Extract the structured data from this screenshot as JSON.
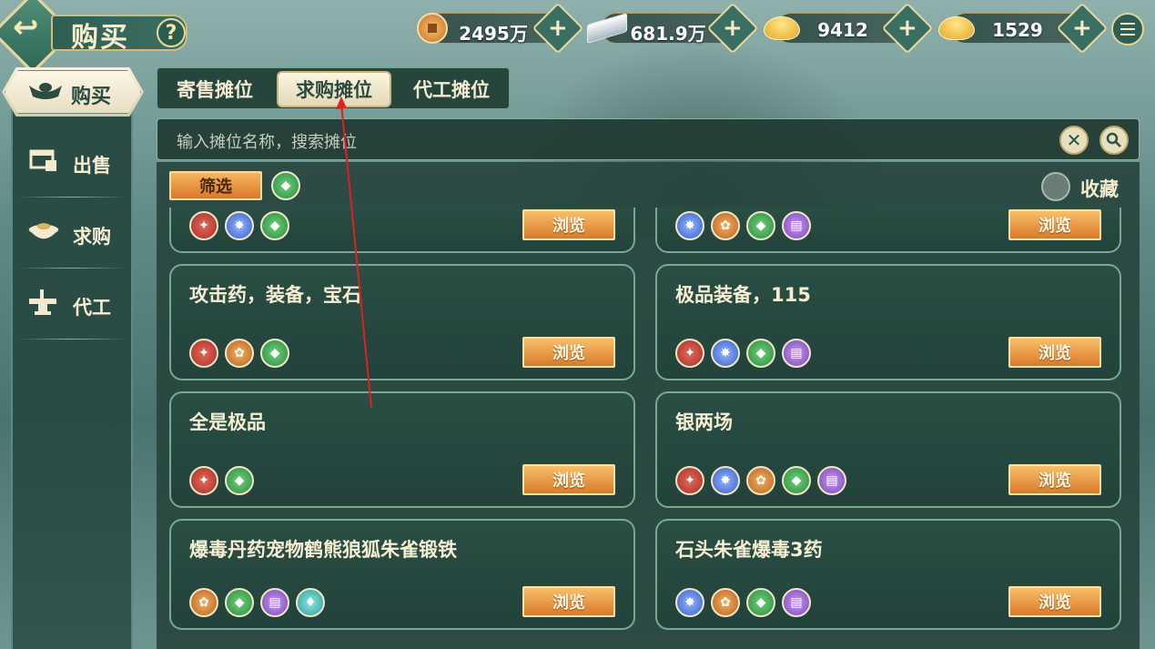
{
  "header": {
    "title": "购买",
    "help": "?",
    "back_icon": "↩"
  },
  "currencies": [
    {
      "icon": "coin-icon",
      "value": "2495万"
    },
    {
      "icon": "silver-icon",
      "value": "681.9万"
    },
    {
      "icon": "gold-bag-icon",
      "value": "9412"
    },
    {
      "icon": "gold-ingot-icon",
      "value": "1529"
    }
  ],
  "sidebar": {
    "items": [
      {
        "label": "购买",
        "icon": "ingot-icon"
      },
      {
        "label": "出售",
        "icon": "stall-icon"
      },
      {
        "label": "求购",
        "icon": "bowl-icon"
      },
      {
        "label": "代工",
        "icon": "anvil-icon"
      }
    ]
  },
  "tabs": [
    {
      "label": "寄售摊位",
      "active": false
    },
    {
      "label": "求购摊位",
      "active": true
    },
    {
      "label": "代工摊位",
      "active": false
    }
  ],
  "search": {
    "placeholder": "输入摊位名称，搜索摊位"
  },
  "filter": {
    "label": "筛选",
    "favorite_label": "收藏"
  },
  "stalls": [
    {
      "title": "",
      "icons": [
        "red",
        "blue",
        "green"
      ],
      "browse": "浏览"
    },
    {
      "title": "",
      "icons": [
        "blue",
        "orange",
        "green",
        "purple"
      ],
      "browse": "浏览"
    },
    {
      "title": "攻击药，装备，宝石",
      "icons": [
        "red",
        "orange",
        "green"
      ],
      "browse": "浏览"
    },
    {
      "title": "极品装备，115",
      "icons": [
        "red",
        "blue",
        "green",
        "purple"
      ],
      "browse": "浏览"
    },
    {
      "title": "全是极品",
      "icons": [
        "red",
        "green"
      ],
      "browse": "浏览"
    },
    {
      "title": "银两场",
      "icons": [
        "red",
        "blue",
        "orange",
        "green",
        "purple"
      ],
      "browse": "浏览"
    },
    {
      "title": "爆毒丹药宠物鹤熊狼狐朱雀锻铁",
      "icons": [
        "orange",
        "green",
        "purple",
        "teal"
      ],
      "browse": "浏览"
    },
    {
      "title": "石头朱雀爆毒3药",
      "icons": [
        "blue",
        "orange",
        "green",
        "purple"
      ],
      "browse": "浏览"
    }
  ],
  "colors": {
    "accent_orange": "#d97a2b",
    "panel_green": "#2a4e44",
    "border_gold": "#e6d79f",
    "annotation_red": "#e02020"
  }
}
